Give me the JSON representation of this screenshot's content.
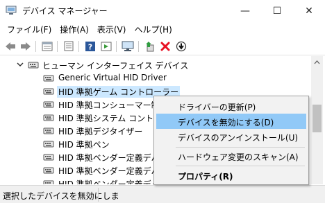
{
  "window": {
    "title": "デバイス マネージャー",
    "min_glyph": "—",
    "max_glyph": "☐",
    "close_glyph": "✕"
  },
  "menu": [
    "ファイル(F)",
    "操作(A)",
    "表示(V)",
    "ヘルプ(H)"
  ],
  "toolbar": {
    "icons": [
      "back-arrow-icon",
      "forward-arrow-icon",
      "properties-icon",
      "view-icon",
      "help-icon",
      "show-hidden-icon",
      "monitor-icon",
      "update-driver-icon",
      "uninstall-x-icon",
      "disable-device-icon"
    ],
    "uninstall_color": "#e81123"
  },
  "tree": {
    "category": "ヒューマン インターフェイス デバイス",
    "devices": [
      "Generic Virtual HID Driver",
      "HID 準拠ゲーム コントローラー",
      "HID 準拠コンシューマー制御デ",
      "HID 準拠システム コントローラー",
      "HID 準拠デジタイザー",
      "HID 準拠ペン",
      "HID 準拠ベンダー定義デバイ",
      "HID 準拠ベンダー定義デバイ",
      "HID 準拠ベンダー定義デバイ"
    ],
    "selected_index": 1
  },
  "context_menu": {
    "update_driver": "ドライバーの更新(P)",
    "disable_device": "デバイスを無効にする(D)",
    "uninstall_device": "デバイスのアンインストール(U)",
    "scan_hardware": "ハードウェア変更のスキャン(A)",
    "properties": "プロパティ(R)",
    "highlight_color": "#91c9f7"
  },
  "status": {
    "text": "選択したデバイスを無効にしま"
  }
}
